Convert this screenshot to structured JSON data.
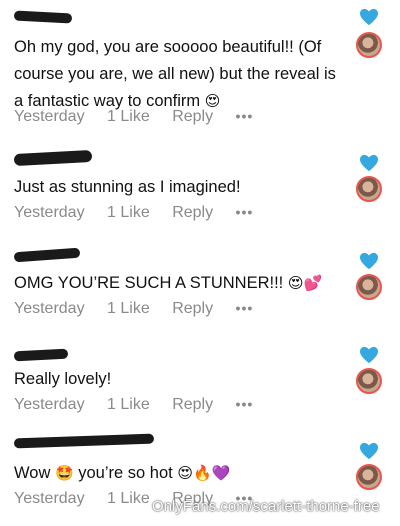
{
  "comments": [
    {
      "text": "Oh my god, you are sooooo beautiful!! (Of course you are, we all new) but the reveal is a fantastic way to confirm",
      "emoji": "😍",
      "time": "Yesterday",
      "likes": "1 Like",
      "reply": "Reply",
      "more": "•••"
    },
    {
      "text": "Just as stunning as I imagined!",
      "emoji": "",
      "time": "Yesterday",
      "likes": "1 Like",
      "reply": "Reply",
      "more": "•••"
    },
    {
      "text": "OMG YOU’RE SUCH A STUNNER!!!",
      "emoji": "😍💕",
      "time": "Yesterday",
      "likes": "1 Like",
      "reply": "Reply",
      "more": "•••"
    },
    {
      "text": "Really lovely!",
      "emoji": "",
      "time": "Yesterday",
      "likes": "1 Like",
      "reply": "Reply",
      "more": "•••"
    },
    {
      "text_before": "Wow",
      "emoji_mid": "🤩",
      "text_after": "you’re so hot",
      "emoji": "😍🔥💜",
      "time": "Yesterday",
      "likes": "1 Like",
      "reply": "Reply",
      "more": "•••"
    }
  ],
  "colors": {
    "heart": "#35a8e0",
    "avatar_ring": "#e8564e",
    "meta": "#8a8a8a"
  },
  "icons": {
    "heart": "heart-icon",
    "avatar": "avatar"
  },
  "watermark": "OnlyFans.com/scarlett-thorne-free"
}
